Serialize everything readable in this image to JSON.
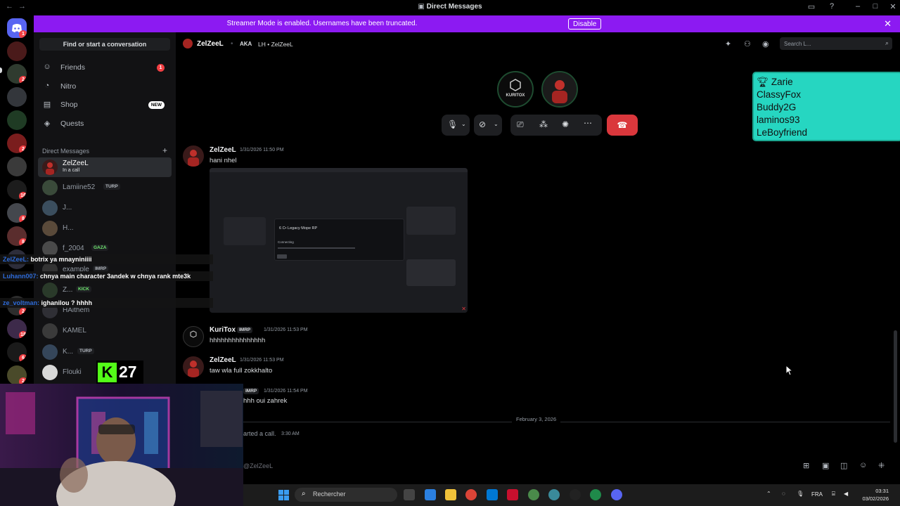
{
  "window": {
    "title": "Direct Messages"
  },
  "banner": {
    "message": "Streamer Mode is enabled. Usernames have been truncated.",
    "disable_label": "Disable"
  },
  "rail": {
    "badges": [
      "1",
      "2",
      "2",
      "8",
      "16",
      "8",
      "2",
      "18",
      "6",
      "2"
    ]
  },
  "sidebar": {
    "find_label": "Find or start a conversation",
    "nav": [
      {
        "label": "Friends",
        "count": "1"
      },
      {
        "label": "Nitro"
      },
      {
        "label": "Shop",
        "badge": "NEW"
      },
      {
        "label": "Quests"
      }
    ],
    "dm_header": "Direct Messages",
    "dms": [
      {
        "name": "ZelZeeL",
        "sub": "In a call"
      },
      {
        "name": "Lamiine52",
        "tag": "TURP"
      },
      {
        "name": "J..."
      },
      {
        "name": "H..."
      },
      {
        "name": "f_2004",
        "tag": "GAZA"
      },
      {
        "name": "example",
        "tag": "IMRP"
      },
      {
        "name": "Z...",
        "tag": "KICK"
      },
      {
        "name": "HAithem"
      },
      {
        "name": "KAMEL"
      },
      {
        "name": "K...",
        "tag": "TURP"
      },
      {
        "name": "Flouki"
      }
    ]
  },
  "header": {
    "username": "ZelZeeL",
    "aka_label": "AKA",
    "aka_value": "LH • ZelZeeL",
    "search_placeholder": "Search L..."
  },
  "overlay": {
    "names": [
      "Zarie",
      "ClassyFox",
      "Buddy2G",
      "laminos93",
      "LeBoyfriend"
    ]
  },
  "messages": [
    {
      "author": "ZelZeeL",
      "time": "1/31/2026 11:50 PM",
      "text": "hani nhel"
    },
    {
      "author": "KuriTox",
      "tag": "IMRP",
      "time": "1/31/2026 11:53 PM",
      "text": "hhhhhhhhhhhhhhh"
    },
    {
      "author": "ZelZeeL",
      "time": "1/31/2026 11:53 PM",
      "text": "taw wla full zokkhalto"
    },
    {
      "author": "",
      "tag": "IMRP",
      "time": "1/31/2026 11:54 PM",
      "text": "hhh oui zahrek"
    }
  ],
  "attachment": {
    "dialog_title": "6 C• Legacy Mope RP",
    "dialog_status": "Connecting"
  },
  "date_divider": "February 3, 2026",
  "system_message": {
    "text": "arted a call.",
    "time": "3:30 AM"
  },
  "composer": {
    "placeholder": "@ZelZeeL"
  },
  "chat_overlay": [
    {
      "user": "ZelZeeL:",
      "text": "botrix ya mnayniniiii"
    },
    {
      "user": "Luhann007:",
      "text": "chnya main character 3andek w chnya rank mte3k"
    },
    {
      "user": "ze_voltman:",
      "text": "ighanilou ? hhhh"
    }
  ],
  "kick": {
    "count": "27"
  },
  "taskbar": {
    "search_placeholder": "Rechercher",
    "lang": "FRA",
    "time": "03:31",
    "date": "03/02/2026"
  },
  "colors": {
    "banner": "#8c1af2",
    "overlay": "#26d6c1",
    "end_call": "#da373c",
    "kick": "#53fc18"
  }
}
